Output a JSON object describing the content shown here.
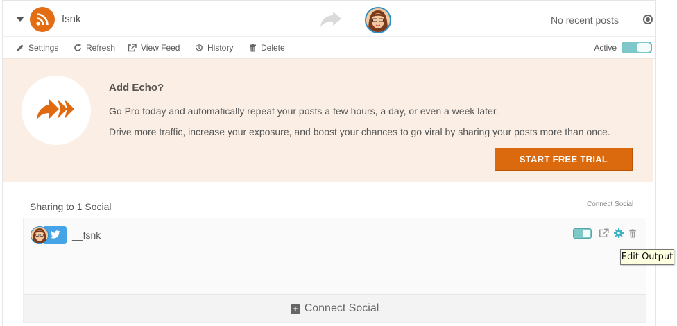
{
  "header": {
    "feed_name": "fsnk",
    "status_text": "No recent posts"
  },
  "toolbar": {
    "settings": "Settings",
    "refresh": "Refresh",
    "view_feed": "View Feed",
    "history": "History",
    "delete": "Delete",
    "active_label": "Active",
    "active": true
  },
  "promo": {
    "title": "Add Echo?",
    "line1": "Go Pro today and automatically repeat your posts a few hours, a day, or even a week later.",
    "line2": "Drive more traffic, increase your exposure, and boost your chances to go viral by sharing your posts more than once.",
    "cta": "START FREE TRIAL"
  },
  "sharing": {
    "title": "Sharing to 1 Social",
    "connect_link": "Connect Social",
    "accounts": [
      {
        "network": "twitter",
        "handle": "__fsnk",
        "enabled": true
      }
    ],
    "connect_button": "Connect Social"
  },
  "tooltip": "Edit Output",
  "colors": {
    "accent_orange": "#db6a0e",
    "promo_bg": "#fbeee4",
    "toggle_teal": "#7ec8c9",
    "twitter_blue": "#45a3e6"
  }
}
